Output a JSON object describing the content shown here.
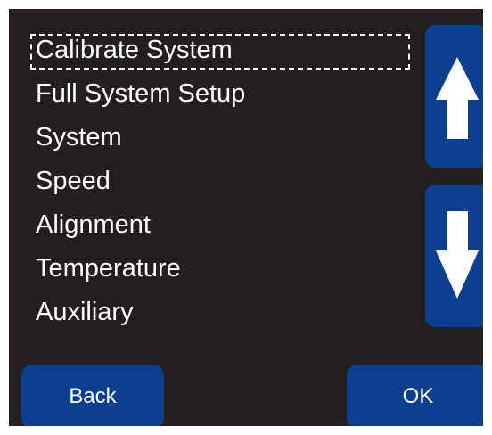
{
  "menu": {
    "items": [
      {
        "label": "Calibrate System",
        "selected": true
      },
      {
        "label": "Full System Setup",
        "selected": false
      },
      {
        "label": "System",
        "selected": false
      },
      {
        "label": "Speed",
        "selected": false
      },
      {
        "label": "Alignment",
        "selected": false
      },
      {
        "label": "Temperature",
        "selected": false
      },
      {
        "label": "Auxiliary",
        "selected": false
      }
    ]
  },
  "scroll": {
    "up_icon": "arrow-up-icon",
    "down_icon": "arrow-down-icon"
  },
  "actions": {
    "back_label": "Back",
    "ok_label": "OK"
  },
  "colors": {
    "screen_background": "#231f20",
    "button_blue": "#0c3f8f",
    "text": "#ffffff"
  }
}
